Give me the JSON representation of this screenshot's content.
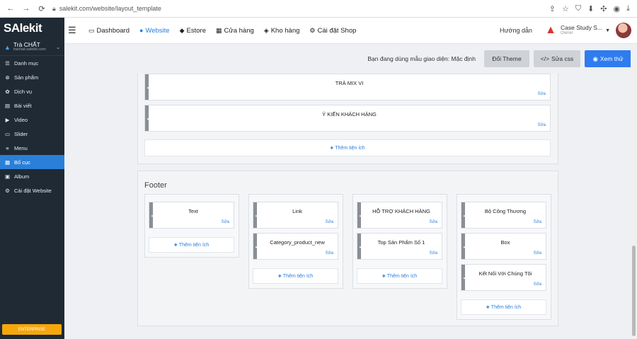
{
  "browser": {
    "url": "salekit.com/website/layout_template"
  },
  "sidebar": {
    "logo": "SAlekit",
    "shop_name": "Trà CHẤT",
    "shop_domain": "trachat.salekit.com",
    "items": [
      {
        "label": "Danh mục",
        "icon": "list-icon"
      },
      {
        "label": "Sản phẩm",
        "icon": "product-icon"
      },
      {
        "label": "Dịch vụ",
        "icon": "service-icon"
      },
      {
        "label": "Bài viết",
        "icon": "article-icon"
      },
      {
        "label": "Video",
        "icon": "video-icon"
      },
      {
        "label": "Slider",
        "icon": "slider-icon"
      },
      {
        "label": "Menu",
        "icon": "menu-icon"
      },
      {
        "label": "Bố cục",
        "icon": "layout-icon"
      },
      {
        "label": "Album",
        "icon": "album-icon"
      },
      {
        "label": "Cài đặt Website",
        "icon": "settings-icon"
      }
    ],
    "active_index": 7,
    "plan_badge": "ENTERPRISE"
  },
  "topnav": {
    "items": [
      {
        "label": "Dashboard",
        "icon": "monitor-icon"
      },
      {
        "label": "Website",
        "icon": "globe-icon"
      },
      {
        "label": "Estore",
        "icon": "store-icon"
      },
      {
        "label": "Cửa hàng",
        "icon": "shop-icon"
      },
      {
        "label": "Kho hàng",
        "icon": "warehouse-icon"
      },
      {
        "label": "Cài đặt Shop",
        "icon": "gear-icon"
      }
    ],
    "active_index": 1,
    "guide": "Hướng dẫn",
    "account_name": "Case Study S...",
    "account_role": "Owner"
  },
  "subbar": {
    "theme_text": "Bạn đang dùng mẫu giao diện: Mặc định",
    "change_theme": "Đổi Theme",
    "edit_css": "Sửa css",
    "preview": "Xem thử"
  },
  "layout": {
    "edit_label": "Sửa",
    "add_label": "Thêm tiện ích",
    "upper_widgets": [
      "TRÀ MIX VI",
      "Ý KIẾN KHÁCH HÀNG"
    ],
    "footer_title": "Footer",
    "footer_columns": [
      [
        "Text"
      ],
      [
        "Link",
        "Category_product_new"
      ],
      [
        "HỖ TRỢ KHÁCH HÀNG",
        "Top Sản Phẩm Số 1"
      ],
      [
        "Bộ Công Thương",
        "Box",
        "Kết Nối Với Chúng Tôi"
      ]
    ]
  },
  "colors": {
    "sidebar_bg": "#1f2a35",
    "accent": "#2b7fd8",
    "primary_button": "#2f7bf0",
    "plan_badge": "#f5a70c"
  }
}
